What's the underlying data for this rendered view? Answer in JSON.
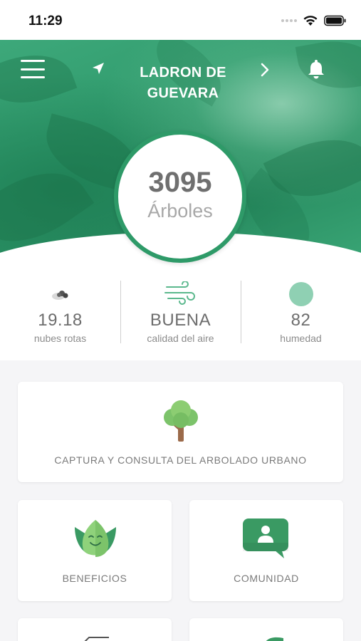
{
  "status_bar": {
    "time": "11:29",
    "icons": [
      "signal-dots-icon",
      "wifi-icon",
      "battery-icon"
    ]
  },
  "header": {
    "city_line1": "LADRON DE",
    "city_line2": "GUEVARA",
    "icons": [
      "menu-icon",
      "location-arrow-icon",
      "chevron-right-icon",
      "bell-icon"
    ]
  },
  "trees": {
    "count": "3095",
    "label": "Árboles"
  },
  "weather": {
    "temperature": {
      "value": "19.18",
      "label": "nubes rotas",
      "icon": "cloud-icon"
    },
    "air_quality": {
      "value": "BUENA",
      "label": "calidad del aire",
      "icon": "wind-icon"
    },
    "humidity": {
      "value": "82",
      "label": "humedad",
      "icon": "humidity-dot-icon"
    }
  },
  "cards": {
    "capture": {
      "label": "CAPTURA Y CONSULTA DEL ARBOLADO URBANO",
      "icon": "tree-icon"
    },
    "benefits": {
      "label": "BENEFICIOS",
      "icon": "smiling-leaf-icon"
    },
    "community": {
      "label": "COMUNIDAD",
      "icon": "chat-person-icon"
    }
  },
  "colors": {
    "brand_green": "#2e9a68",
    "light_green": "#8fd0b3",
    "text_gray": "#7a7a7a"
  }
}
